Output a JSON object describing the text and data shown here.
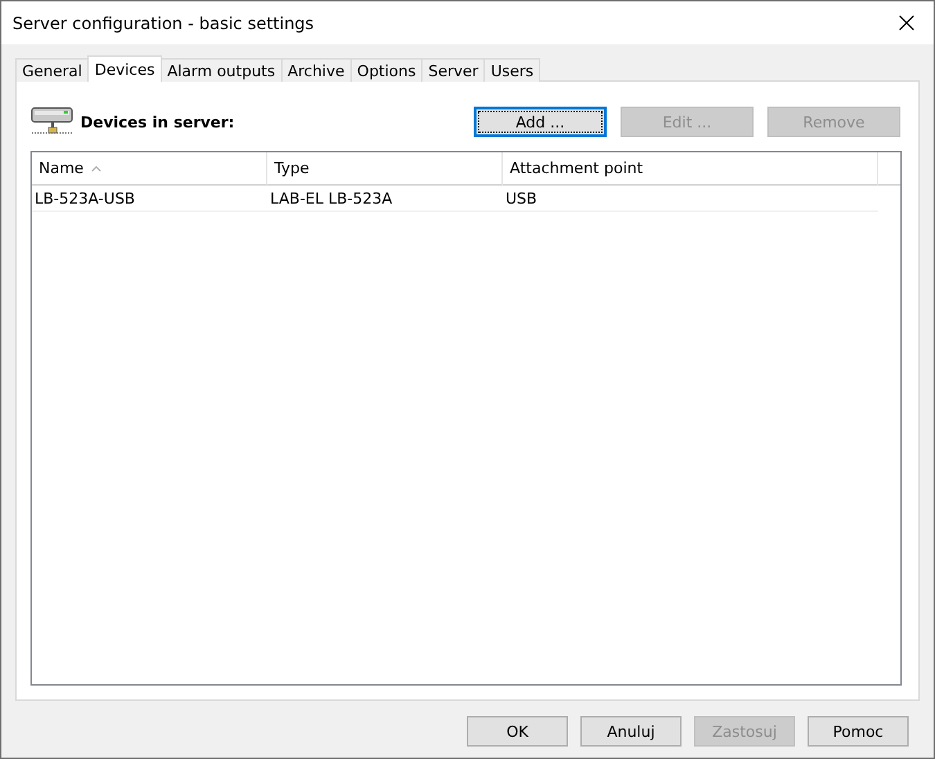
{
  "window": {
    "title": "Server configuration - basic settings"
  },
  "tabs": [
    {
      "label": "General",
      "selected": false
    },
    {
      "label": "Devices",
      "selected": true
    },
    {
      "label": "Alarm outputs",
      "selected": false
    },
    {
      "label": "Archive",
      "selected": false
    },
    {
      "label": "Options",
      "selected": false
    },
    {
      "label": "Server",
      "selected": false
    },
    {
      "label": "Users",
      "selected": false
    }
  ],
  "section": {
    "title": "Devices in server:"
  },
  "actions": [
    {
      "label": "Add ...",
      "disabled": false,
      "focused": true
    },
    {
      "label": "Edit ...",
      "disabled": true,
      "focused": false
    },
    {
      "label": "Remove",
      "disabled": true,
      "focused": false
    }
  ],
  "table": {
    "columns": [
      {
        "label": "Name",
        "sorted": true
      },
      {
        "label": "Type",
        "sorted": false
      },
      {
        "label": "Attachment point",
        "sorted": false
      }
    ],
    "rows": [
      [
        "LB-523A-USB",
        "LAB-EL LB-523A",
        "USB"
      ]
    ]
  },
  "buttons": [
    {
      "label": "OK",
      "disabled": false
    },
    {
      "label": "Anuluj",
      "disabled": false
    },
    {
      "label": "Zastosuj",
      "disabled": true
    },
    {
      "label": "Pomoc",
      "disabled": false
    }
  ]
}
